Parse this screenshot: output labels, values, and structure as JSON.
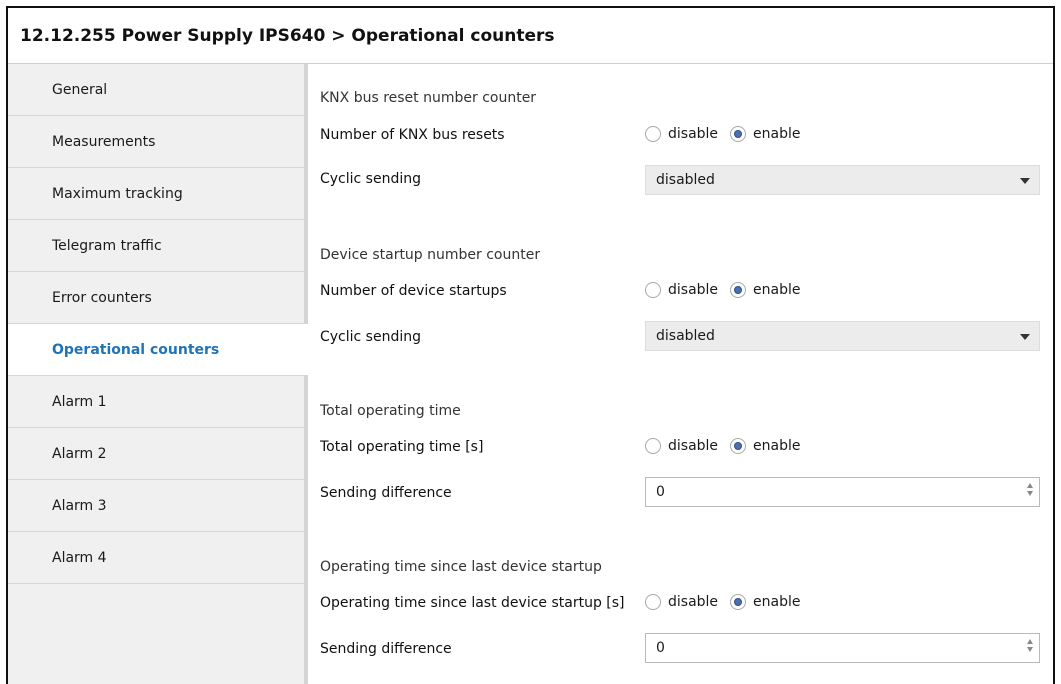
{
  "window": {
    "title": "12.12.255 Power Supply IPS640 > Operational counters"
  },
  "sidebar": {
    "items": [
      {
        "label": "General",
        "active": false
      },
      {
        "label": "Measurements",
        "active": false
      },
      {
        "label": "Maximum tracking",
        "active": false
      },
      {
        "label": "Telegram traffic",
        "active": false
      },
      {
        "label": "Error counters",
        "active": false
      },
      {
        "label": "Operational counters",
        "active": true
      },
      {
        "label": "Alarm 1",
        "active": false
      },
      {
        "label": "Alarm 2",
        "active": false
      },
      {
        "label": "Alarm 3",
        "active": false
      },
      {
        "label": "Alarm 4",
        "active": false
      }
    ]
  },
  "sections": [
    {
      "title": "KNX bus reset number counter",
      "toggle": {
        "label": "Number of KNX bus resets",
        "options": [
          "disable",
          "enable"
        ],
        "selected": "enable"
      },
      "setting": {
        "label": "Cyclic sending",
        "type": "select",
        "value": "disabled"
      }
    },
    {
      "title": "Device startup number counter",
      "toggle": {
        "label": "Number of device startups",
        "options": [
          "disable",
          "enable"
        ],
        "selected": "enable"
      },
      "setting": {
        "label": "Cyclic sending",
        "type": "select",
        "value": "disabled"
      }
    },
    {
      "title": "Total operating time",
      "toggle": {
        "label": "Total operating time [s]",
        "options": [
          "disable",
          "enable"
        ],
        "selected": "enable"
      },
      "setting": {
        "label": "Sending difference",
        "type": "spinner",
        "value": "0"
      }
    },
    {
      "title": "Operating time since last device startup",
      "toggle": {
        "label": "Operating time since last device startup [s]",
        "options": [
          "disable",
          "enable"
        ],
        "selected": "enable"
      },
      "setting": {
        "label": "Sending difference",
        "type": "spinner",
        "value": "0"
      }
    }
  ],
  "colors": {
    "accent": "#1f73b7",
    "sidebar_bg": "#f0f0f0",
    "radio_fill": "#4b6fb0"
  }
}
